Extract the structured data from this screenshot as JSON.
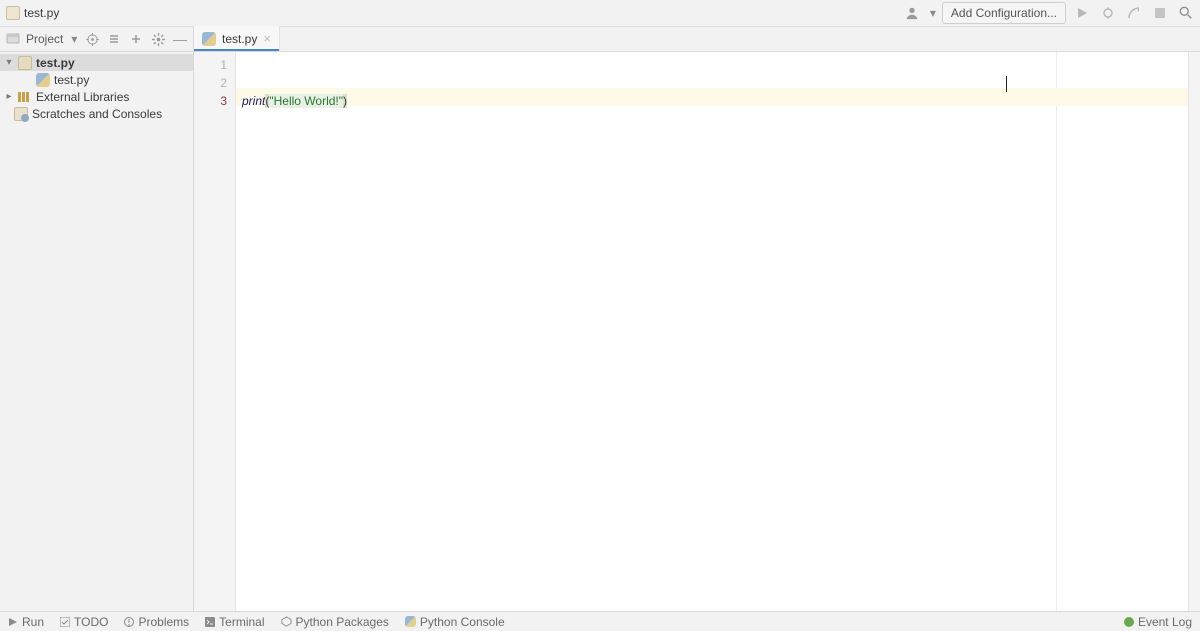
{
  "breadcrumb": {
    "file": "test.py"
  },
  "toolbar": {
    "add_config_label": "Add Configuration..."
  },
  "project_panel": {
    "label": "Project",
    "tree": {
      "root": "test.py",
      "child_file": "test.py",
      "external_libs": "External Libraries",
      "scratches": "Scratches and Consoles"
    }
  },
  "tabs": [
    {
      "name": "test.py"
    }
  ],
  "editor": {
    "gutter": [
      "1",
      "2",
      "3"
    ],
    "active_line_index": 2,
    "code": {
      "print_kw": "print",
      "open_paren": "(",
      "string": "\"Hello World!\"",
      "close_paren": ")"
    }
  },
  "bottom": {
    "run": "Run",
    "todo": "TODO",
    "problems": "Problems",
    "terminal": "Terminal",
    "py_packages": "Python Packages",
    "py_console": "Python Console",
    "event_log": "Event Log"
  }
}
